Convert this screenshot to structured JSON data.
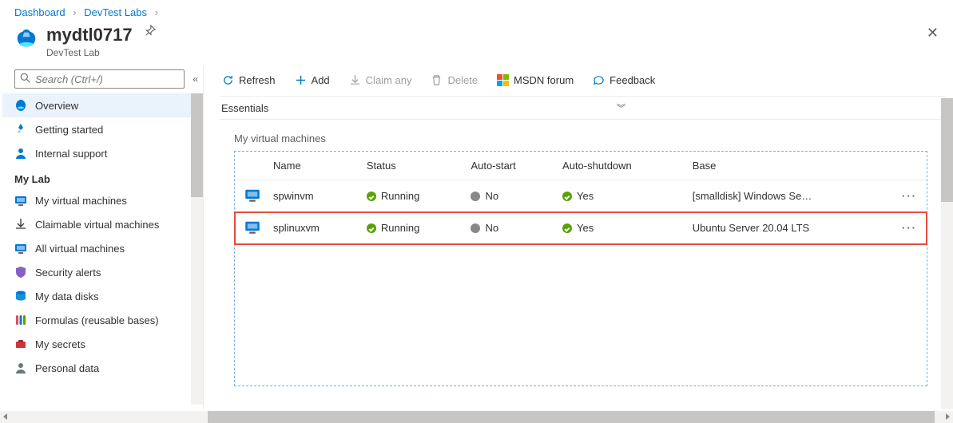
{
  "breadcrumb": {
    "dashboard": "Dashboard",
    "devtestlabs": "DevTest Labs"
  },
  "header": {
    "title": "mydtl0717",
    "subtitle": "DevTest Lab"
  },
  "search": {
    "placeholder": "Search (Ctrl+/)"
  },
  "sidebar": {
    "top": [
      {
        "label": "Overview"
      },
      {
        "label": "Getting started"
      },
      {
        "label": "Internal support"
      }
    ],
    "section1_title": "My Lab",
    "section1": [
      {
        "label": "My virtual machines"
      },
      {
        "label": "Claimable virtual machines"
      },
      {
        "label": "All virtual machines"
      },
      {
        "label": "Security alerts"
      },
      {
        "label": "My data disks"
      },
      {
        "label": "Formulas (reusable bases)"
      },
      {
        "label": "My secrets"
      },
      {
        "label": "Personal data"
      }
    ]
  },
  "toolbar": {
    "refresh": "Refresh",
    "add": "Add",
    "claim": "Claim any",
    "delete": "Delete",
    "msdn": "MSDN forum",
    "feedback": "Feedback"
  },
  "essentials_label": "Essentials",
  "vm_section_title": "My virtual machines",
  "vm_table": {
    "headers": {
      "name": "Name",
      "status": "Status",
      "autostart": "Auto-start",
      "autoshutdown": "Auto-shutdown",
      "base": "Base"
    },
    "rows": [
      {
        "name": "spwinvm",
        "status": "Running",
        "autostart": "No",
        "autoshutdown": "Yes",
        "base": "[smalldisk] Windows Se…"
      },
      {
        "name": "splinuxvm",
        "status": "Running",
        "autostart": "No",
        "autoshutdown": "Yes",
        "base": "Ubuntu Server 20.04 LTS"
      }
    ]
  }
}
